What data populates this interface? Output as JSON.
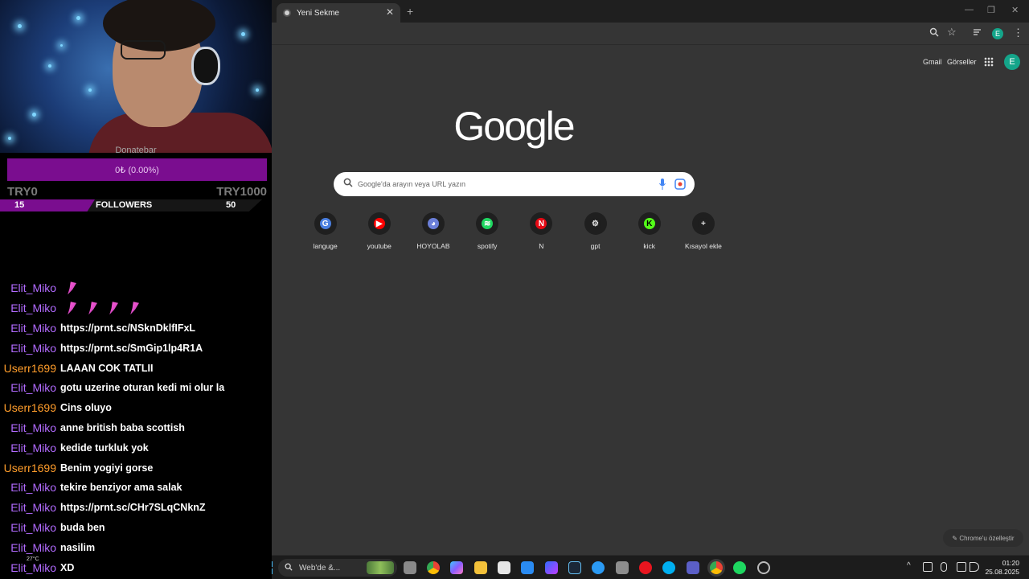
{
  "overlay": {
    "donate_title": "Donatebar",
    "donate_value": "0₺ (0.00%)",
    "try_min": "TRY0",
    "try_max": "TRY1000",
    "followers_current": "15",
    "followers_label": "FOLLOWERS",
    "followers_goal": "50",
    "weather_temp": "27°C"
  },
  "chat": [
    {
      "user": "Elit_Miko",
      "color": "purple",
      "msg": "",
      "feathers": 1
    },
    {
      "user": "Elit_Miko",
      "color": "purple",
      "msg": "",
      "feathers": 4
    },
    {
      "user": "Elit_Miko",
      "color": "purple",
      "msg": "https://prnt.sc/NSknDklfIFxL"
    },
    {
      "user": "Elit_Miko",
      "color": "purple",
      "msg": "https://prnt.sc/SmGip1lp4R1A"
    },
    {
      "user": "Userr1699",
      "color": "orange",
      "msg": "LAAAN COK TATLII"
    },
    {
      "user": "Elit_Miko",
      "color": "purple",
      "msg": "gotu uzerine oturan kedi mi olur la"
    },
    {
      "user": "Userr1699",
      "color": "orange",
      "msg": "Cins oluyo"
    },
    {
      "user": "Elit_Miko",
      "color": "purple",
      "msg": "anne british baba scottish"
    },
    {
      "user": "Elit_Miko",
      "color": "purple",
      "msg": "kedide turkluk yok"
    },
    {
      "user": "Userr1699",
      "color": "orange",
      "msg": "Benim yogiyi gorse"
    },
    {
      "user": "Elit_Miko",
      "color": "purple",
      "msg": "tekire benziyor ama salak"
    },
    {
      "user": "Elit_Miko",
      "color": "purple",
      "msg": "https://prnt.sc/CHr7SLqCNknZ"
    },
    {
      "user": "Elit_Miko",
      "color": "purple",
      "msg": "buda ben"
    },
    {
      "user": "Elit_Miko",
      "color": "purple",
      "msg": "nasilim"
    },
    {
      "user": "Elit_Miko",
      "color": "purple",
      "msg": "XD"
    }
  ],
  "browser": {
    "tab_title": "Yeni Sekme",
    "tab_close": "✕",
    "new_tab": "+",
    "minimize": "—",
    "maximize": "❐",
    "close": "✕",
    "profile_initial": "E",
    "gmail": "Gmail",
    "images": "Görseller",
    "logo": "Google",
    "search_placeholder": "Google'da arayın veya URL yazın",
    "shortcuts": [
      {
        "label": "languge",
        "icon": "translate-icon",
        "color": "#4a7fe0",
        "glyph": "G"
      },
      {
        "label": "youtube",
        "icon": "youtube-icon",
        "color": "#ff0000",
        "glyph": "▶"
      },
      {
        "label": "HOYOLAB",
        "icon": "hoyolab-icon",
        "color": "#6b7fd8",
        "glyph": "◕"
      },
      {
        "label": "spotify",
        "icon": "spotify-icon",
        "color": "#1ed760",
        "glyph": "≋"
      },
      {
        "label": "N",
        "icon": "netflix-icon",
        "color": "#e50914",
        "glyph": "N"
      },
      {
        "label": "gpt",
        "icon": "chatgpt-icon",
        "color": "#1f1f1f",
        "glyph": "⚙"
      },
      {
        "label": "kick",
        "icon": "kick-icon",
        "color": "#53fc18",
        "glyph": "K"
      },
      {
        "label": "Kısayol ekle",
        "icon": "add-shortcut-icon",
        "color": "#1f1f1f",
        "glyph": "+"
      }
    ],
    "customize": "✎ Chrome'u özelleştir"
  },
  "taskbar": {
    "search_label": "Web'de &...",
    "time": "01:20",
    "date": "25.08.2025",
    "tray_up": "^"
  }
}
